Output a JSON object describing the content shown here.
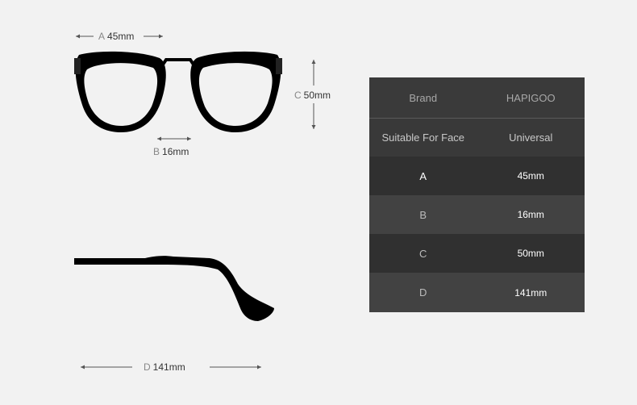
{
  "dimensions": {
    "a": {
      "letter": "A",
      "value": "45mm"
    },
    "b": {
      "letter": "B",
      "value": "16mm"
    },
    "c": {
      "letter": "C",
      "value": "50mm"
    },
    "d": {
      "letter": "D",
      "value": "141mm"
    }
  },
  "spec_table": {
    "header": {
      "key": "Brand",
      "value": "HAPIGOO"
    },
    "face": {
      "key": "Suitable For Face",
      "value": "Universal"
    },
    "rows": [
      {
        "key": "A",
        "value": "45mm"
      },
      {
        "key": "B",
        "value": "16mm"
      },
      {
        "key": "C",
        "value": "50mm"
      },
      {
        "key": "D",
        "value": "141mm"
      }
    ]
  },
  "colors": {
    "background": "#f2f2f2",
    "frame": "#000000",
    "table_bg": "#373737"
  }
}
